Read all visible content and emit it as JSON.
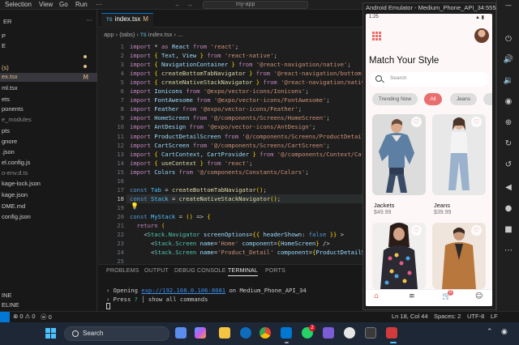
{
  "menubar": {
    "items": [
      "Selection",
      "View",
      "Go",
      "Run",
      "···"
    ],
    "command_center": "my-app"
  },
  "explorer": {
    "header": "ER",
    "items": [
      {
        "label": "P"
      },
      {
        "label": "E"
      },
      {
        "label": "(s)",
        "mod": true
      },
      {
        "label": "ex.tsx",
        "mod": true,
        "badge": "M",
        "selected": true
      },
      {
        "label": "ml.tsx"
      },
      {
        "label": "ets"
      },
      {
        "label": "ponents"
      },
      {
        "label": "e_modules",
        "dim": true
      },
      {
        "label": "pts"
      },
      {
        "label": "gnore"
      },
      {
        "label": ".json"
      },
      {
        "label": "el.config.js"
      },
      {
        "label": "o-env.d.ts",
        "dim": true
      },
      {
        "label": "kage-lock.json"
      },
      {
        "label": "kage.json"
      },
      {
        "label": "DME.md"
      },
      {
        "label": "config.json"
      }
    ],
    "footer": [
      "INE",
      "ELINE"
    ]
  },
  "editor": {
    "tab": {
      "label": "index.tsx",
      "modified": "M"
    },
    "breadcrumb": [
      "app",
      "(tabs)",
      "index.tsx",
      "..."
    ],
    "line_numbers": [
      "1",
      "2",
      "3",
      "4",
      "5",
      "6",
      "7",
      "8",
      "9",
      "10",
      "11",
      "12",
      "13",
      "14",
      "15",
      "16",
      "17",
      "18",
      "19",
      "20",
      "21",
      "22",
      "23",
      "24",
      "25"
    ],
    "lines": [
      "import * as React from 'react';",
      "import { Text, View } from 'react-native';",
      "import { NavigationContainer } from '@react-navigation/native';",
      "import { createBottomTabNavigator } from '@react-navigation/bottom-tabs';",
      "import { createNativeStackNavigator } from '@react-navigation/native-stack';",
      "import Ionicons from '@expo/vector-icons/Ionicons';",
      "import FontAwesome from '@expo/vector-icons/FontAwesome';",
      "import Feather from '@expo/vector-icons/Feather';",
      "import HomeScreen from '@/components/Screens/HomeScreen';",
      "import AntDesign from '@expo/vector-icons/AntDesign';",
      "import ProductDetailScreen from '@/components/Screens/ProductDetailScreen';",
      "import CartScreen from '@/components/Screens/CartScreen';",
      "import { CartContext, CartProvider } from '@/components/Context/CartContext';",
      "import { useContext } from 'react';",
      "import Colors from '@/components/Constants/Colors';",
      "",
      "const Tab = createBottomTabNavigator();",
      "const Stack = createNativeStackNavigator();",
      "",
      "const MyStack = () => {",
      "  return (",
      "    <Stack.Navigator screenOptions={{ headerShown: false }} >",
      "      <Stack.Screen name='Home' component={HomeScreen} />",
      "      <Stack.Screen name='Product_Detail' component={ProductDetailScreen} />",
      ""
    ]
  },
  "panel": {
    "tabs": [
      "PROBLEMS",
      "OUTPUT",
      "DEBUG CONSOLE",
      "TERMINAL",
      "PORTS"
    ],
    "active_tab": "TERMINAL",
    "terminal": {
      "line1_prefix": "› Opening ",
      "line1_url": "exp://192.168.0.106:8081",
      "line1_suffix": " on Medium_Phone_API_34",
      "line2_prefix": "› Press ",
      "line2_key": "?",
      "line2_suffix": " │ show all commands"
    }
  },
  "statusbar": {
    "left": [
      "⊗ 0 ⚠ 0",
      "ⓦ 0"
    ],
    "right": [
      "Ln 18, Col 44",
      "Spaces: 2",
      "UTF-8",
      "LF",
      "{} TypeScript",
      "ly"
    ]
  },
  "emulator": {
    "title": "Android Emulator - Medium_Phone_API_34:5554",
    "status_time": "1:25",
    "app": {
      "title": "Match Your Style",
      "search_placeholder": "Search",
      "chips": [
        {
          "label": "Trending Now",
          "active": false
        },
        {
          "label": "All",
          "active": true
        },
        {
          "label": "Jeans",
          "active": false
        },
        {
          "label": "",
          "active": false
        }
      ],
      "products": [
        {
          "name": "Jackets",
          "price": "$49.99"
        },
        {
          "name": "Jeans",
          "price": "$39.99"
        },
        {
          "name": "",
          "price": ""
        },
        {
          "name": "",
          "price": ""
        }
      ],
      "nav": [
        "home-icon",
        "list-icon",
        "cart-icon",
        "user-icon"
      ],
      "cart_count": "0"
    },
    "side_toolbar": [
      "power-icon",
      "volume-up-icon",
      "volume-down-icon",
      "rotate-icon",
      "rotate-icon",
      "camera-icon",
      "zoom-icon",
      "back-icon",
      "home-icon",
      "square-icon",
      "more-icon"
    ]
  },
  "taskbar": {
    "search_label": "Search",
    "apps": [
      "explorer-app",
      "copilot-app",
      "file-explorer-app",
      "chrome-app",
      "vscode-app",
      "whatsapp-app",
      "nodes-app",
      "github-app",
      "terminal-app",
      "emulator-app"
    ],
    "whatsapp_badge": "2"
  },
  "colors": {
    "accent": "#0078d4",
    "app_accent": "#e96e6e",
    "editor_bg": "#1e1e1e",
    "phone_bg": "#fdf8f7"
  }
}
